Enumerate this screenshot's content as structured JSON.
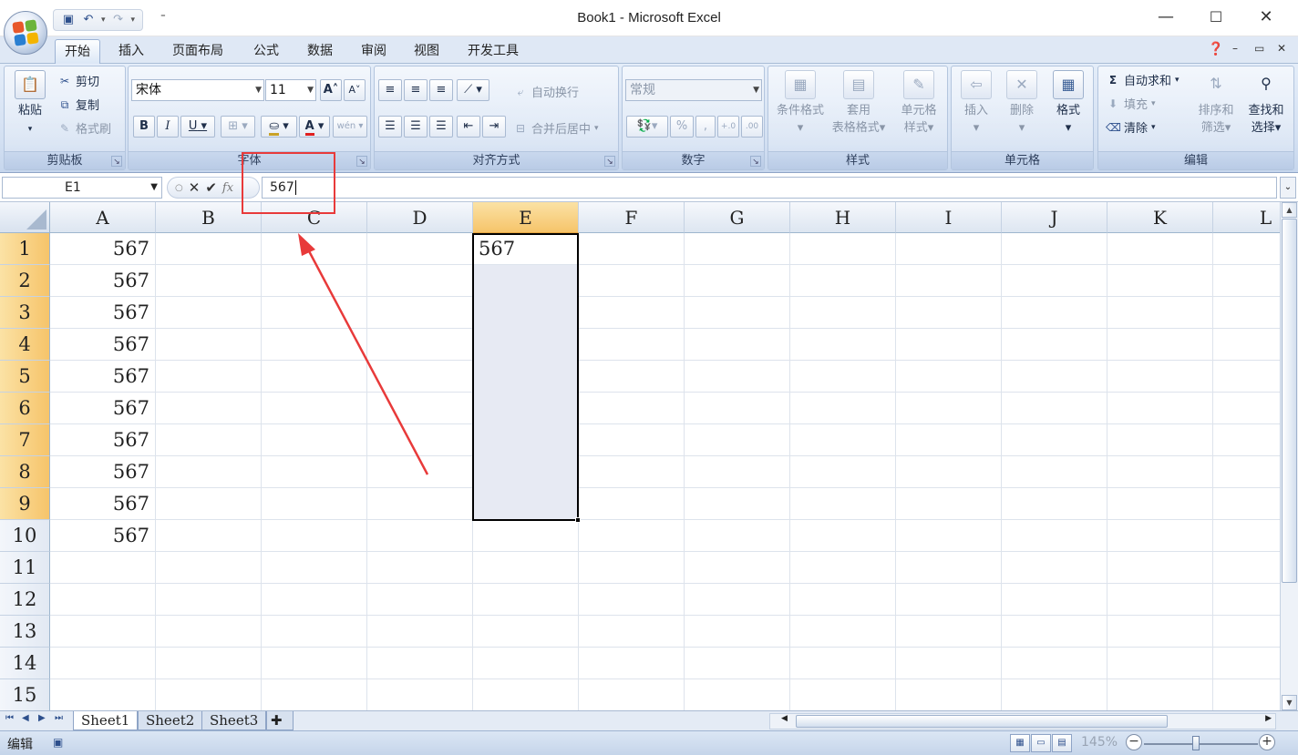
{
  "window": {
    "title": "Book1 - Microsoft Excel",
    "minimize": "—",
    "maximize": "☐",
    "close": "✕"
  },
  "qat": {
    "customize": "⁼"
  },
  "tabs": [
    {
      "label": "开始",
      "active": true
    },
    {
      "label": "插入"
    },
    {
      "label": "页面布局"
    },
    {
      "label": "公式"
    },
    {
      "label": "数据"
    },
    {
      "label": "审阅"
    },
    {
      "label": "视图"
    },
    {
      "label": "开发工具"
    }
  ],
  "ribbon": {
    "clipboard": {
      "label": "剪贴板",
      "paste": "粘贴",
      "cut": "剪切",
      "copy": "复制",
      "format_painter": "格式刷"
    },
    "font": {
      "label": "字体",
      "font_name": "宋体",
      "font_size": "11",
      "bold": "B",
      "italic": "I",
      "underline": "U",
      "font_color": "A",
      "grow": "A˄",
      "shrink": "A˅",
      "phonetic": "wén",
      "font_color_hex": "#e02020"
    },
    "alignment": {
      "label": "对齐方式",
      "wrap_text": "自动换行",
      "merge_center": "合并后居中"
    },
    "number": {
      "label": "数字",
      "format": "常规",
      "percent": "%",
      "comma": ",",
      "inc_decimal": "+.0",
      "dec_decimal": ".00"
    },
    "styles": {
      "label": "样式",
      "conditional_format": "条件格式",
      "format_table_1": "套用",
      "format_table_2": "表格格式",
      "cell_styles_1": "单元格",
      "cell_styles_2": "样式"
    },
    "cells": {
      "label": "单元格",
      "insert": "插入",
      "delete": "删除",
      "format": "格式"
    },
    "editing": {
      "label": "编辑",
      "autosum": "自动求和",
      "fill": "填充",
      "clear": "清除",
      "sort_filter_1": "排序和",
      "sort_filter_2": "筛选",
      "find_select_1": "查找和",
      "find_select_2": "选择"
    }
  },
  "formula_bar": {
    "name_box": "E1",
    "value": "567"
  },
  "columns": [
    "A",
    "B",
    "C",
    "D",
    "E",
    "F",
    "G",
    "H",
    "I",
    "J",
    "K",
    "L"
  ],
  "selected_column": "E",
  "rows": [
    "1",
    "2",
    "3",
    "4",
    "5",
    "6",
    "7",
    "8",
    "9",
    "10",
    "11",
    "12",
    "13",
    "14",
    "15"
  ],
  "selected_rows": [
    "1",
    "2",
    "3",
    "4",
    "5",
    "6",
    "7",
    "8",
    "9"
  ],
  "cells": {
    "A": [
      "567",
      "567",
      "567",
      "567",
      "567",
      "567",
      "567",
      "567",
      "567",
      "567"
    ],
    "E1": "567"
  },
  "sheets": [
    {
      "label": "Sheet1",
      "active": true
    },
    {
      "label": "Sheet2"
    },
    {
      "label": "Sheet3"
    }
  ],
  "status": {
    "mode": "编辑",
    "zoom": "145%"
  },
  "colors": {
    "accent": "#f6c46a",
    "annotation": "#e83a3a",
    "ribbon": "#d3e0f2"
  }
}
